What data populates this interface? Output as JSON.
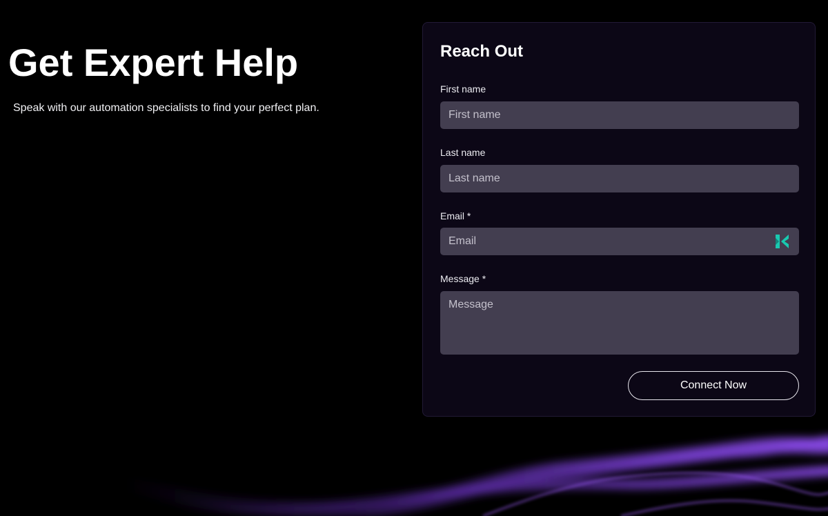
{
  "hero": {
    "title": "Get Expert Help",
    "subtitle": "Speak with our automation specialists to find your perfect plan."
  },
  "form": {
    "title": "Reach Out",
    "fields": [
      {
        "label": "First name",
        "placeholder": "First name"
      },
      {
        "label": "Last name",
        "placeholder": "Last name"
      },
      {
        "label": "Email *",
        "placeholder": "Email",
        "icon": "autofill-extension-icon"
      },
      {
        "label": "Message *",
        "placeholder": "Message"
      }
    ],
    "submit_label": "Connect Now"
  },
  "colors": {
    "background": "#000000",
    "card": "#0c0716",
    "input": "#433e50",
    "accent_icon": "#19c9b0",
    "wave": "#7a3fd6"
  }
}
